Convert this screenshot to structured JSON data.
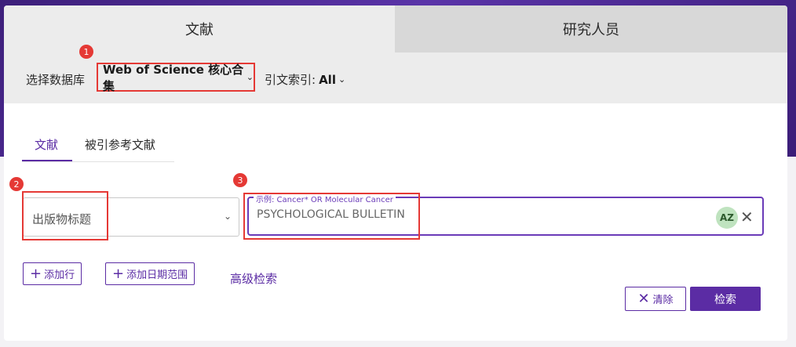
{
  "top_tabs": [
    {
      "label": "文献"
    },
    {
      "label": "研究人员"
    }
  ],
  "database": {
    "label": "选择数据库",
    "selected": "Web of Science 核心合集",
    "citation_index_label": "引文索引:",
    "citation_index_value": "All"
  },
  "sub_tabs": [
    {
      "label": "文献"
    },
    {
      "label": "被引参考文献"
    }
  ],
  "search_row": {
    "field_selected": "出版物标题",
    "query_placeholder": "示例: Cancer* OR Molecular Cancer",
    "query_value": "PSYCHOLOGICAL BULLETIN",
    "az_label": "AZ"
  },
  "actions": {
    "add_row": "添加行",
    "add_date_range": "添加日期范围",
    "advanced_search": "高级检索",
    "clear": "清除",
    "search": "检索"
  },
  "annotations": [
    "1",
    "2",
    "3"
  ],
  "colors": {
    "accent": "#5b2ca4",
    "highlight_box": "#e53935",
    "header_band": "#4b2e83"
  }
}
